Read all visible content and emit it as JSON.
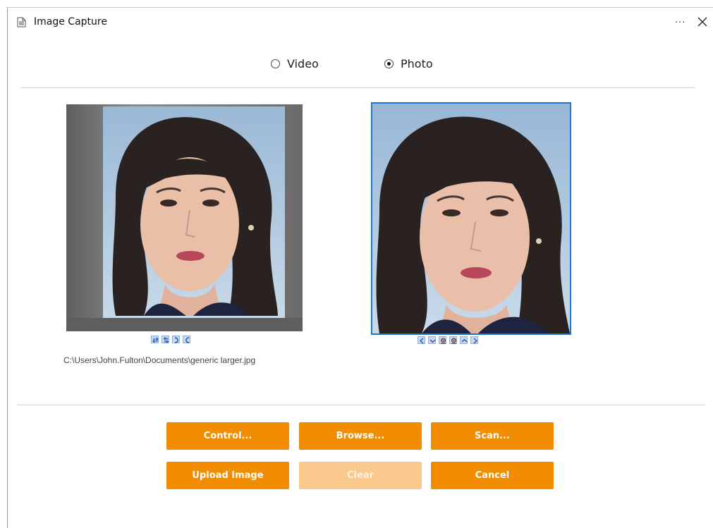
{
  "window": {
    "title": "Image Capture",
    "more_label": "...",
    "close_icon": "close-icon"
  },
  "modes": {
    "video_label": "Video",
    "photo_label": "Photo",
    "selected": "Photo"
  },
  "source_image": {
    "file_path": "C:\\Users\\John.Fulton\\Documents\\generic larger.jpg",
    "tools": [
      "flip-horizontal-icon",
      "flip-vertical-icon",
      "rotate-right-icon",
      "rotate-left-icon"
    ]
  },
  "crop_image": {
    "tools": [
      "move-left-icon",
      "move-down-icon",
      "zoom-in-icon",
      "zoom-out-icon",
      "move-up-icon",
      "move-right-icon"
    ]
  },
  "buttons": {
    "control": "Control...",
    "browse": "Browse...",
    "scan": "Scan...",
    "upload": "Upload Image",
    "clear": "Clear",
    "cancel": "Cancel"
  },
  "colors": {
    "accent": "#f28c00",
    "accent_disabled": "#f9c98d",
    "selection_border": "#1c79d0"
  }
}
